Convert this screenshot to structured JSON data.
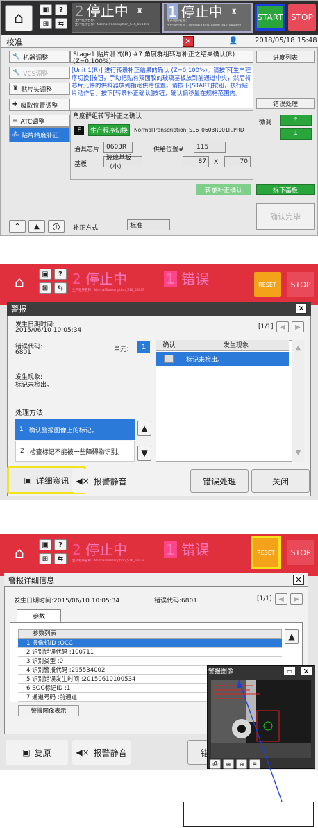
{
  "panel1": {
    "status1": {
      "num": "2",
      "text": "停止中",
      "sub1": "生产程序名称：",
      "sub2": "生产程序名称：NormalTranscription_S16_0603R0"
    },
    "status2": {
      "num": "1",
      "text": "停止中",
      "sub1": "生产程序名称：",
      "sub2": "生产程序名称：NormalTranscription_S16_0603R0"
    },
    "start": "START",
    "stop": "STOP",
    "title": "校准",
    "datetime": "2018/05/18 15:48",
    "nav": [
      "机器调整",
      "VCS调整",
      "贴片头调整",
      "吸取位置调整",
      "ATC调整",
      "贴片精度补正"
    ],
    "stage": "Stage1 贴片测试(R) #7 角度群组转写补正之结果确认(R)(Z=0,100%)",
    "progress_list": "进度列表",
    "message": "[Unit 1(R)] 进行转录补正结果的确认 (Z=0,100%)。请按下[生产程序切换]按钮，手动把贴有双面胶的玻璃基板放到前通道中央，然后将芯片元件的供料器放到指定供给位置。请按下[START]按钮，执行贴片动作后，按下[转录补正确认]按钮，确认偏移量在规格范围内。",
    "error_handling": "错误处理",
    "group_title": "角度群组转写补正之确认",
    "f_label": "F",
    "switch_prog": "生产程序切换",
    "prog_name": "NormalTranscription_S16_0603R001R.PRD",
    "chip_label": "治具芯片",
    "chip_val": "0603R",
    "feed_label": "供给位置#",
    "feed_val": "115",
    "board_label": "基板",
    "board_val": "玻璃基板（小）",
    "board_x": "87",
    "x_sep": "X",
    "board_y": "70",
    "fine_label": "微调",
    "confirm_transfer": "转录补正确认",
    "remove_board": "拆下基板",
    "confirm_done": "确认完毕",
    "method_label": "补正方式",
    "method_val": "标准"
  },
  "panel2": {
    "status1": {
      "num": "2",
      "text": "停止中",
      "sub": "生产程序名称：NormalTranscription_S16_0603R"
    },
    "status2": {
      "num": "1",
      "text": "错误"
    },
    "reset": "RESET",
    "stop": "STOP",
    "title": "警报",
    "date_label": "发生日期时间:",
    "date_val": "2015/06/10 10:05:34",
    "page": "[1/1]",
    "code_label": "错误代码:",
    "code_val": "6801",
    "unit_label": "单元：",
    "unit_val": "1",
    "col_confirm": "确认",
    "col_phenom": "发生现象",
    "phenom_row": "标记未检出。",
    "phenom_label": "发生现象:",
    "phenom_val": "标记未检出。",
    "method_label": "处理方法",
    "methods": [
      {
        "n": "1",
        "t": "确认警报图像上的标记。"
      },
      {
        "n": "2",
        "t": "检查标记不能被一些障碍物识别。"
      }
    ],
    "detail": "详细资讯",
    "silence": "报警静音",
    "handle": "错误处理",
    "close": "关闭"
  },
  "panel3": {
    "status1": {
      "num": "2",
      "text": "停止中",
      "sub": "生产程序名称：NormalTranscription_S16_0603R"
    },
    "status2": {
      "num": "1",
      "text": "错误"
    },
    "reset": "RESET",
    "stop": "STOP",
    "title": "警报详细信息",
    "date": "发生日期时间:2015/06/10 10:05:34",
    "code": "错误代码:6801",
    "page": "[1/1]",
    "tab": "参数",
    "list_header": "参数列表",
    "params": [
      "1 摄像机ID :OCC",
      "2 识别错误代码 :100711",
      "3 识别类型 :0",
      "4 识别警报代码 :295534002",
      "5 识别错误发生时间 :20150610100534",
      "6 BOC标记ID :1",
      "7 通道号码 :前通道"
    ],
    "show_image": "警报图像表示",
    "restore": "复原",
    "silence": "报警静音",
    "handle_part": "错",
    "img_title": "警报图像"
  }
}
